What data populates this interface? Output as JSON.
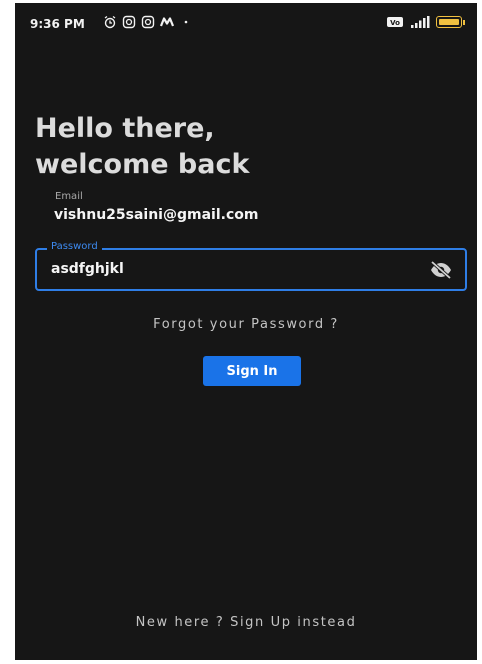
{
  "status_bar": {
    "time": "9:36 PM",
    "left_icons": [
      "alarm-icon",
      "instagram-icon",
      "instagram-icon",
      "mail-icon",
      "dot-icon"
    ],
    "right_icons": [
      "vowifi-icon",
      "signal-icon",
      "battery-icon"
    ],
    "battery_color": "#f0c040"
  },
  "greeting": {
    "line1": "Hello there,",
    "line2": "welcome back"
  },
  "email": {
    "label": "Email",
    "value": "vishnu25saini@gmail.com"
  },
  "password": {
    "label": "Password",
    "value": "asdfghjkl",
    "toggle_icon": "eye-off-icon"
  },
  "forgot_password_label": "Forgot your Password ?",
  "sign_in_label": "Sign In",
  "sign_up_label": "New here ? Sign Up instead",
  "colors": {
    "background": "#161616",
    "accent": "#1a73e8",
    "field_border": "#2f7ee6",
    "text_primary": "#f5f5f5",
    "text_secondary": "#c4c4c4"
  }
}
